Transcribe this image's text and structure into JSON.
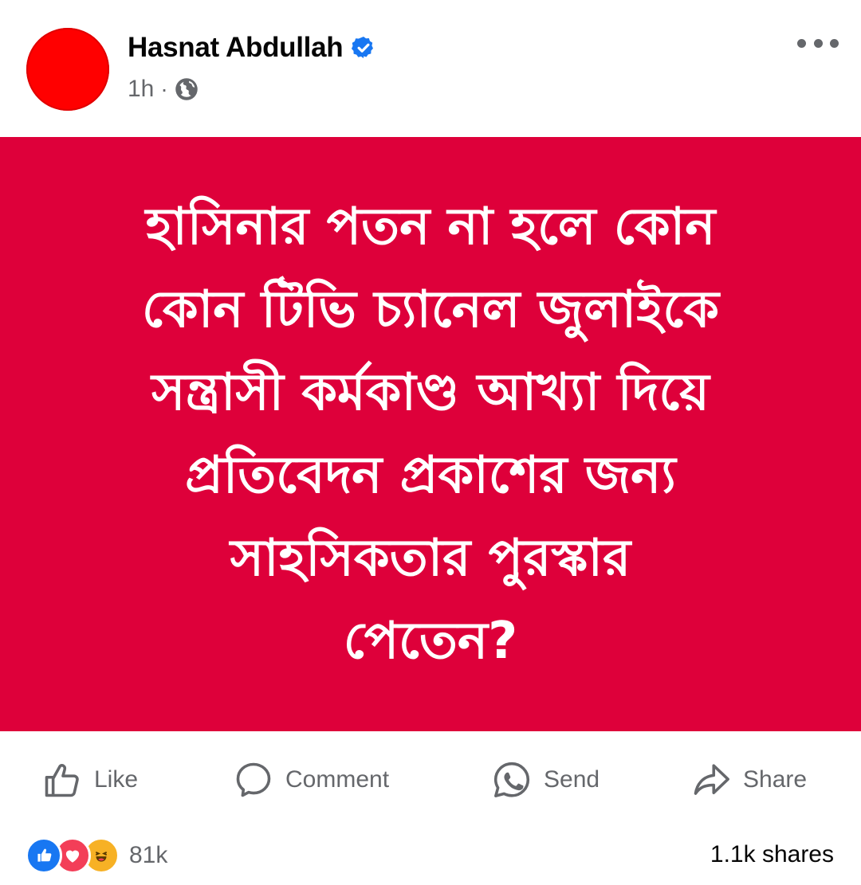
{
  "header": {
    "author_name": "Hasnat Abdullah",
    "time": "1h",
    "separator": "·",
    "privacy_icon": "globe-icon",
    "verified_icon": "verified-badge-icon",
    "more_icon": "more-horizontal-icon"
  },
  "banner": {
    "background_color": "#de003a",
    "text_color": "#ffffff",
    "lines": [
      "হাসিনার পতন না হলে কোন",
      "কোন টিভি চ্যানেল জুলাইকে",
      "সন্ত্রাসী কর্মকাণ্ড আখ্যা দিয়ে",
      "প্রতিবেদন প্রকাশের জন্য",
      "সাহসিকতার পুরস্কার",
      "পেতেন?"
    ]
  },
  "actions": {
    "like_label": "Like",
    "comment_label": "Comment",
    "send_label": "Send",
    "share_label": "Share"
  },
  "stats": {
    "reaction_icons": [
      "like-reaction-icon",
      "love-reaction-icon",
      "haha-reaction-icon"
    ],
    "reaction_count": "81k",
    "shares": "1.1k shares"
  },
  "colors": {
    "accent_blue": "#1877f2",
    "secondary_text": "#65676b",
    "primary_text": "#050505"
  }
}
